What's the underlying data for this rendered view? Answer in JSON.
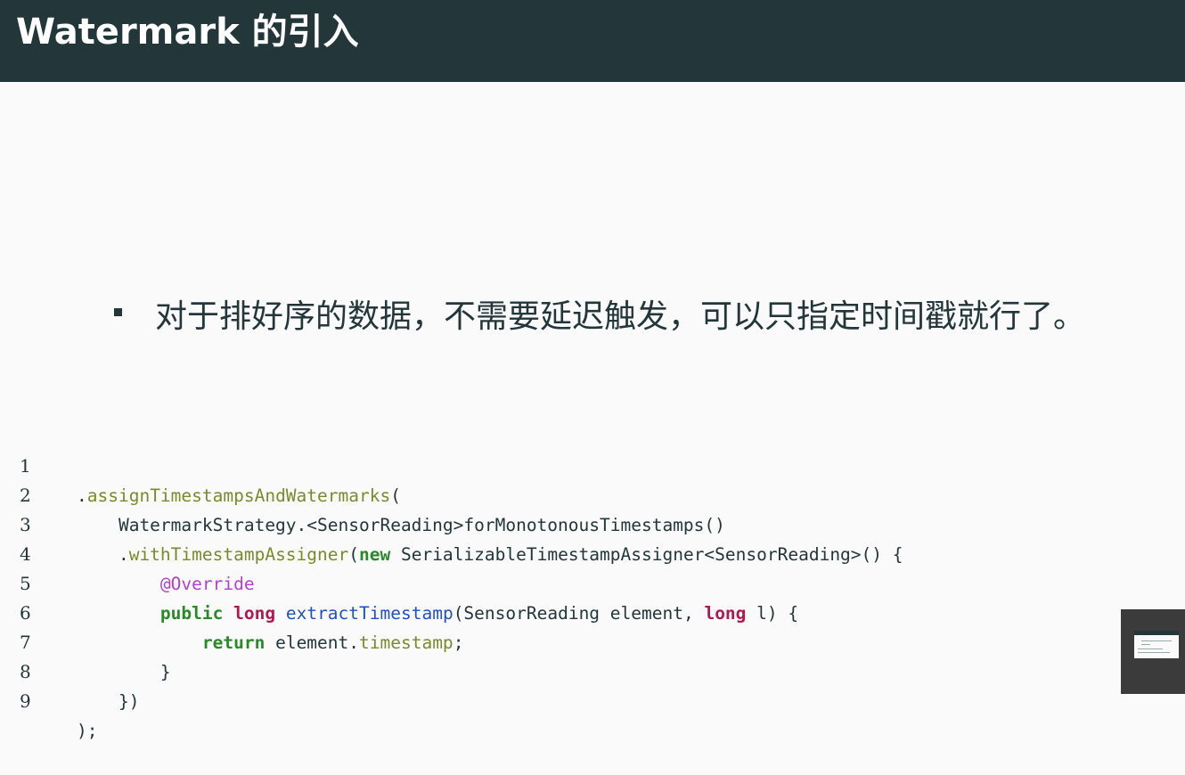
{
  "slide": {
    "title": "Watermark 的引入",
    "bullet": "对于排好序的数据，不需要延迟触发，可以只指定时间戳就行了。"
  },
  "code": {
    "line_numbers": [
      "1",
      "2",
      "3",
      "4",
      "5",
      "6",
      "7",
      "8",
      "9"
    ]
  },
  "colors": {
    "header_bg": "#23373b",
    "method": "#7b8a2e",
    "keyword_green": "#2a8a2a",
    "keyword_red": "#b0194f",
    "annotation": "#b341d4",
    "function_blue": "#2150c8"
  }
}
